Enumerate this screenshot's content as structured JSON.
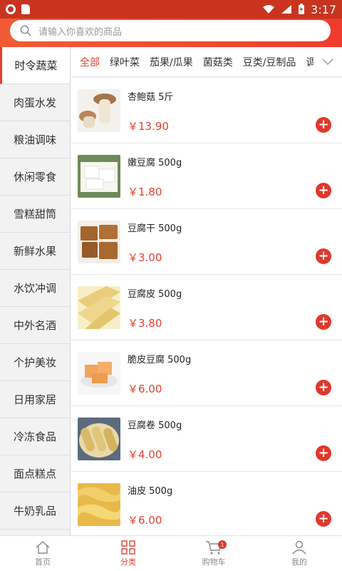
{
  "status": {
    "time": "3:17"
  },
  "search": {
    "placeholder": "请输入你喜欢的商品"
  },
  "categories": [
    "时令蔬菜",
    "肉蛋水发",
    "粮油调味",
    "休闲零食",
    "雪糕甜筒",
    "新鲜水果",
    "水饮冲调",
    "中外名酒",
    "个护美妆",
    "日用家居",
    "冷冻食品",
    "面点糕点",
    "牛奶乳品"
  ],
  "tabs": [
    "全部",
    "绿叶菜",
    "茄果/瓜果",
    "菌菇类",
    "豆类/豆制品",
    "调味"
  ],
  "products": [
    {
      "name": "杏鲍菇  5斤",
      "price": "￥13.90",
      "img": "mushroom"
    },
    {
      "name": "嫩豆腐  500g",
      "price": "￥1.80",
      "img": "tofu"
    },
    {
      "name": "豆腐干  500g",
      "price": "￥3.00",
      "img": "driedtofu"
    },
    {
      "name": "豆腐皮  500g",
      "price": "￥3.80",
      "img": "tofuskin"
    },
    {
      "name": "脆皮豆腐  500g",
      "price": "￥6.00",
      "img": "crispytofu"
    },
    {
      "name": "豆腐卷  500g",
      "price": "￥4.00",
      "img": "tofuroll"
    },
    {
      "name": "油皮  500g",
      "price": "￥6.00",
      "img": "yuba"
    }
  ],
  "bottom_nav": {
    "home": "首页",
    "category": "分类",
    "cart": "购物车",
    "cart_badge": "1",
    "mine": "我的"
  },
  "colors": {
    "accent": "#e63f2f",
    "header": "#ef3b2c"
  }
}
